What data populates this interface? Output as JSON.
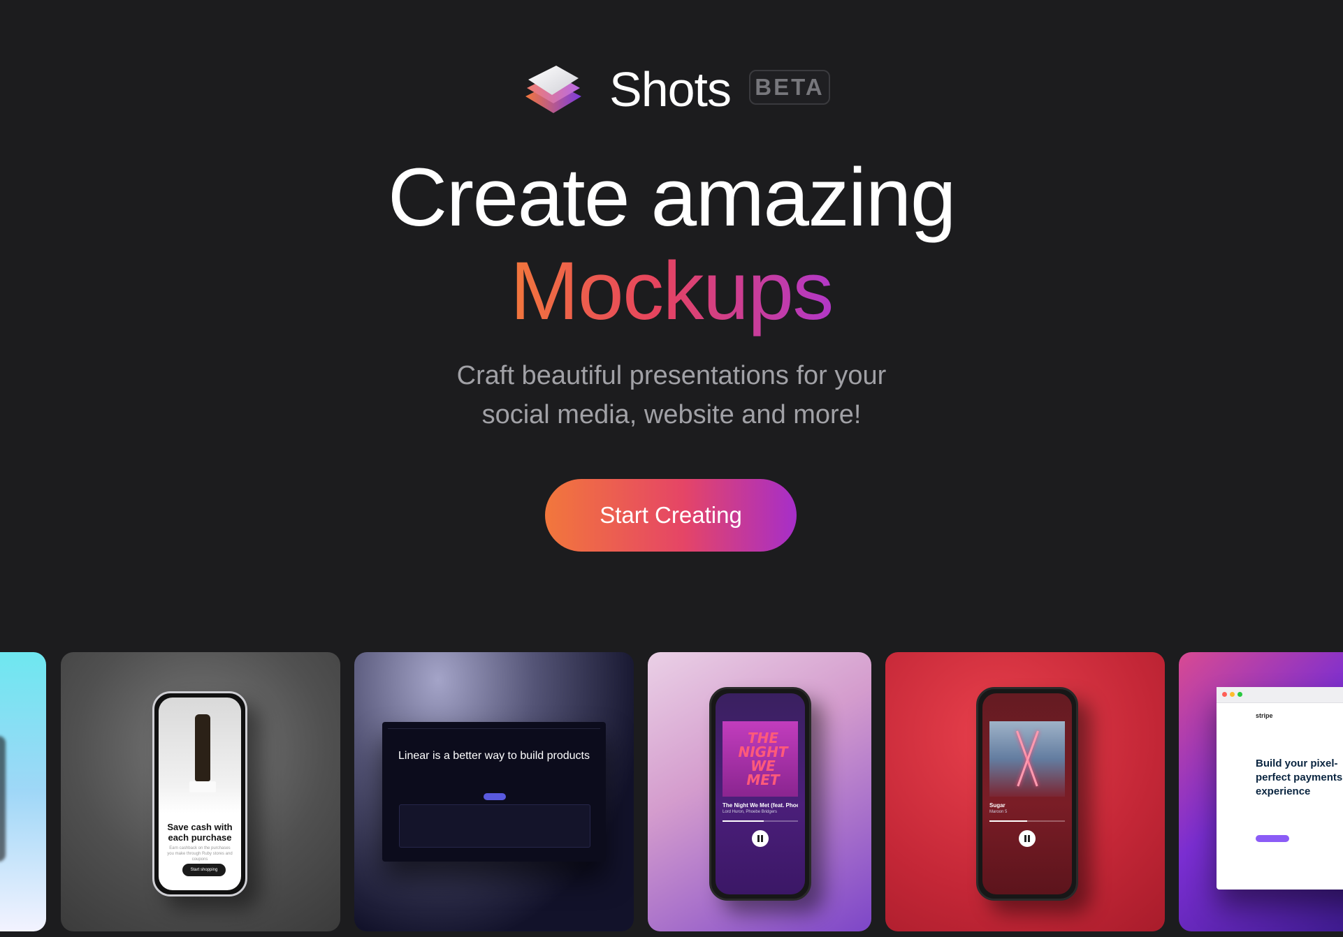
{
  "brand": {
    "name": "Shots",
    "badge": "BETA",
    "logo_icon": "stacked-layers-icon"
  },
  "hero": {
    "headline": "Create amazing",
    "headline_accent": "Mockups",
    "subtitle_lines": [
      "Craft beautiful presentations for your",
      "social media, website and more!"
    ],
    "cta_label": "Start Creating"
  },
  "colors": {
    "background": "#1c1c1e",
    "gradient_start": "#f2773c",
    "gradient_mid": "#e6445e",
    "gradient_end": "#b238c8",
    "subtitle": "#a1a1a6"
  },
  "gallery": {
    "cards": [
      {
        "kind": "partial-mockup"
      },
      {
        "kind": "phone-mockup",
        "title": "Save cash with each purchase",
        "body": "Earn cashback on the purchases you make through Ruby stores and coupons",
        "button": "Start shopping"
      },
      {
        "kind": "browser-mockup",
        "title": "Linear is a better way to build products"
      },
      {
        "kind": "phone-mockup",
        "album_text": "THE NIGHT WE MET",
        "song": "The Night We Met (feat. Phoebe Bridgers)",
        "artist": "Lord Huron, Phoebe Bridgers",
        "progress": 0.55
      },
      {
        "kind": "phone-mockup",
        "song": "Sugar",
        "artist": "Maroon 5",
        "progress": 0.5
      },
      {
        "kind": "browser-mockup",
        "logo": "stripe",
        "title": "Build your pixel-perfect payments experience"
      }
    ]
  }
}
